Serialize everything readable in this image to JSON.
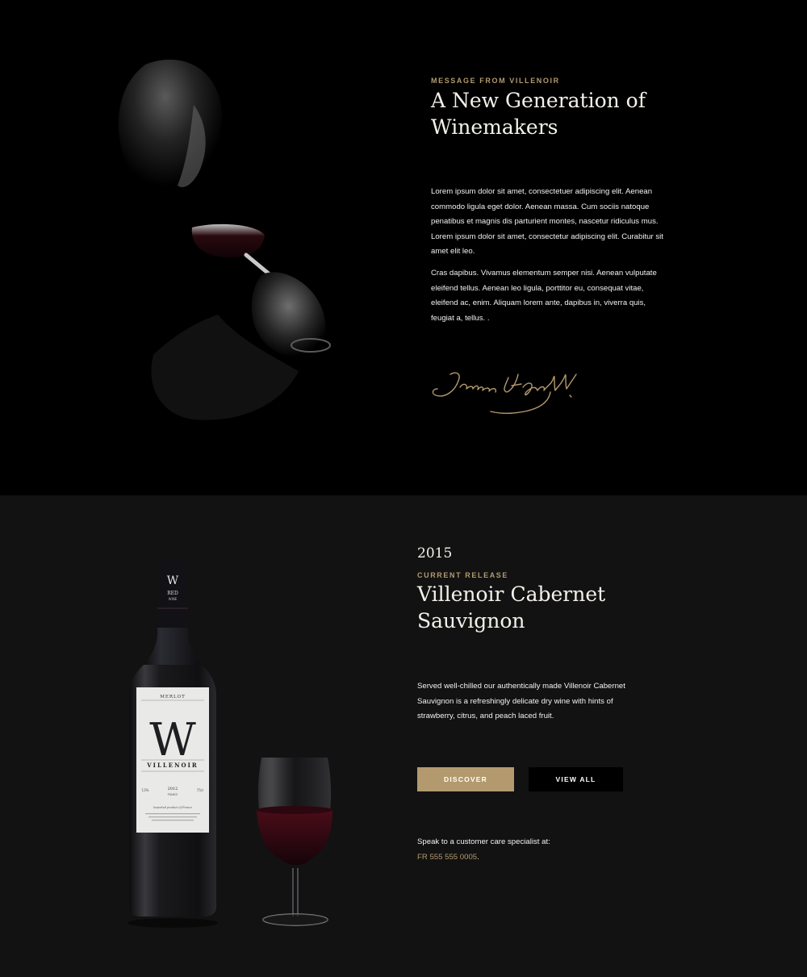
{
  "colors": {
    "accent_gold": "#b39a6e",
    "section1_bg": "#000000",
    "section2_bg": "#121213",
    "button_dark": "#000000"
  },
  "message": {
    "eyebrow": "MESSAGE FROM VILLENOIR",
    "title": "A New Generation of Winemakers",
    "paragraph1": "Lorem ipsum dolor sit amet, consectetuer adipiscing elit. Aenean commodo ligula eget dolor. Aenean massa. Cum sociis natoque penatibus et magnis dis parturient montes, nascetur ridiculus mus. Lorem ipsum dolor sit amet, consectetur adipiscing elit. Curabitur sit amet elit leo.",
    "paragraph2": "Cras dapibus. Vivamus elementum semper nisi. Aenean vulputate eleifend tellus. Aenean leo ligula, porttitor eu, consequat vitae, eleifend ac, enim. Aliquam lorem ante, dapibus in, viverra quis, feugiat a, tellus. .",
    "signature": "James A. Garfield",
    "image_icon": "wine-taster-photo"
  },
  "release": {
    "year": "2015",
    "eyebrow": "CURRENT RELEASE",
    "title": "Villenoir Cabernet Sauvignon",
    "description": "Served well-chilled our authentically made Villenoir Cabernet Sauvignon is a refreshingly delicate dry wine with hints of strawberry, citrus, and peach laced fruit.",
    "discover_label": "DISCOVER",
    "view_all_label": "VIEW ALL",
    "care_label": "Speak to a customer care specialist at:",
    "care_phone": "FR 555 555 0005",
    "care_phone_suffix": "."
  },
  "bottle_label": {
    "neck_mark": "W",
    "neck_text_1": "RED",
    "neck_text_2": "WINE",
    "variety": "MERLOT",
    "monogram": "W",
    "brand": "VILLENOIR",
    "year": "2012",
    "origin": "FRANCE",
    "volume": "75cl",
    "abv": "13%",
    "tagline": "Imported product of France"
  }
}
